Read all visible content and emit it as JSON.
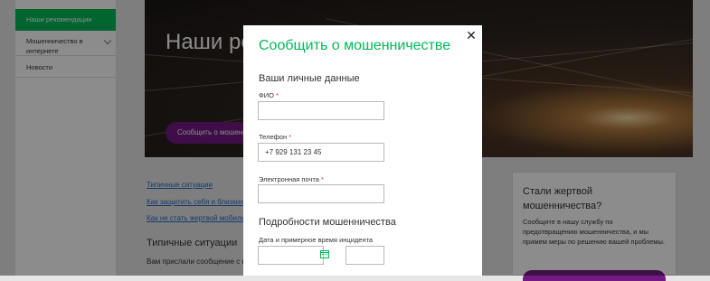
{
  "sidebar": {
    "items": [
      {
        "label": "Наши рекомендации"
      },
      {
        "label": "Мошенничество в интернете"
      },
      {
        "label": "Новости"
      }
    ]
  },
  "hero": {
    "title": "Наши ре",
    "button_label": "Сообщить о мошенн"
  },
  "links": [
    "Типичные ситуации",
    "Как защитить себя и близких",
    "Как не стать жертвой мобиль"
  ],
  "section": {
    "heading": "Типичные ситуации",
    "text": "Вам прислали сообщение с пр"
  },
  "side_card": {
    "title": "Стали жертвой мошенничества?",
    "text": "Сообщите в нашу службу по предотвращению мошенничества, и мы примем меры по решению вашей проблемы."
  },
  "modal": {
    "title": "Сообщить о мошенничестве",
    "close_icon": "close-icon",
    "personal_heading": "Ваши личные данные",
    "fields": {
      "fio": {
        "label": "ФИО",
        "required_mark": "*",
        "value": ""
      },
      "phone": {
        "label": "Телефон",
        "required_mark": "*",
        "value": "+7 929 131 23 45"
      },
      "email": {
        "label": "Электронная почта",
        "required_mark": "*",
        "value": ""
      }
    },
    "details_heading": "Подробности мошенничества",
    "date_label": "Дата и примерное время инцидента",
    "date_value": "",
    "time_value": "",
    "calendar_icon": "calendar-icon"
  },
  "colors": {
    "accent_green": "#00b956",
    "brand_purple": "#731982",
    "required_red": "#e0303a",
    "link_blue": "#2a6cc7"
  }
}
